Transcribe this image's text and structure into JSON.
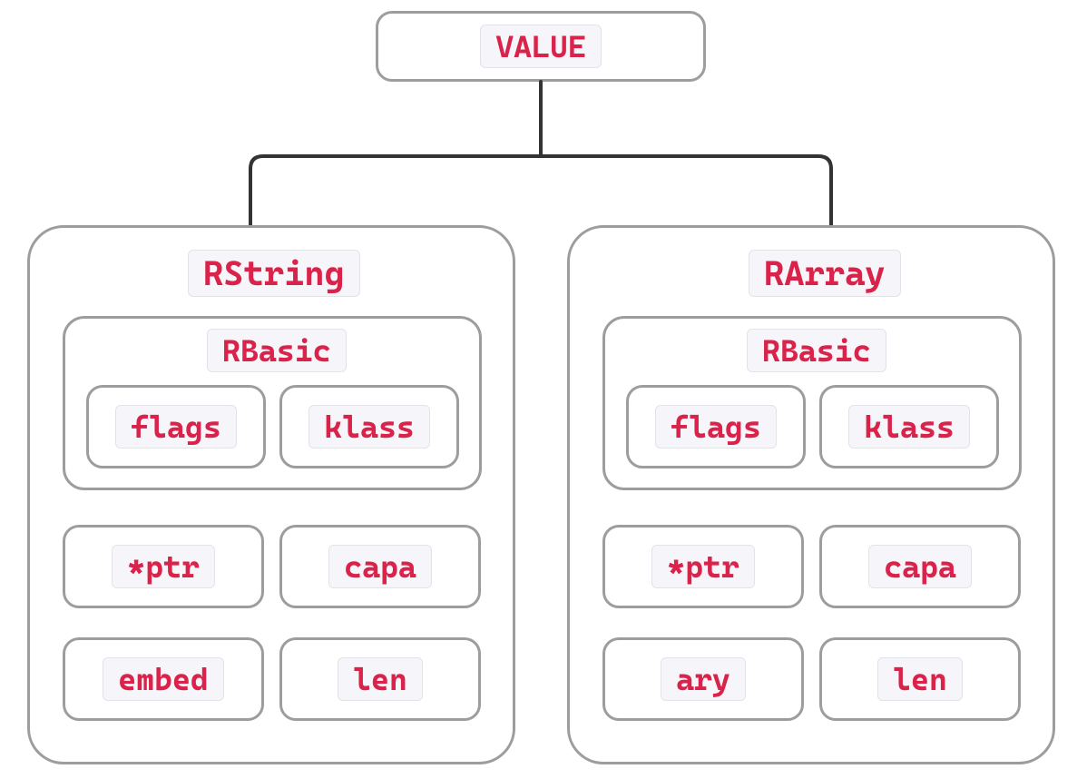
{
  "root": {
    "label": "VALUE"
  },
  "left": {
    "title": "RString",
    "rbasic": {
      "title": "RBasic",
      "flags": "flags",
      "klass": "klass"
    },
    "ptr": "*ptr",
    "capa": "capa",
    "extra": "embed",
    "len": "len"
  },
  "right": {
    "title": "RArray",
    "rbasic": {
      "title": "RBasic",
      "flags": "flags",
      "klass": "klass"
    },
    "ptr": "*ptr",
    "capa": "capa",
    "extra": "ary",
    "len": "len"
  },
  "colors": {
    "accent": "#d9234b",
    "border": "#9d9d9d",
    "chipBg": "#f6f6fa"
  }
}
